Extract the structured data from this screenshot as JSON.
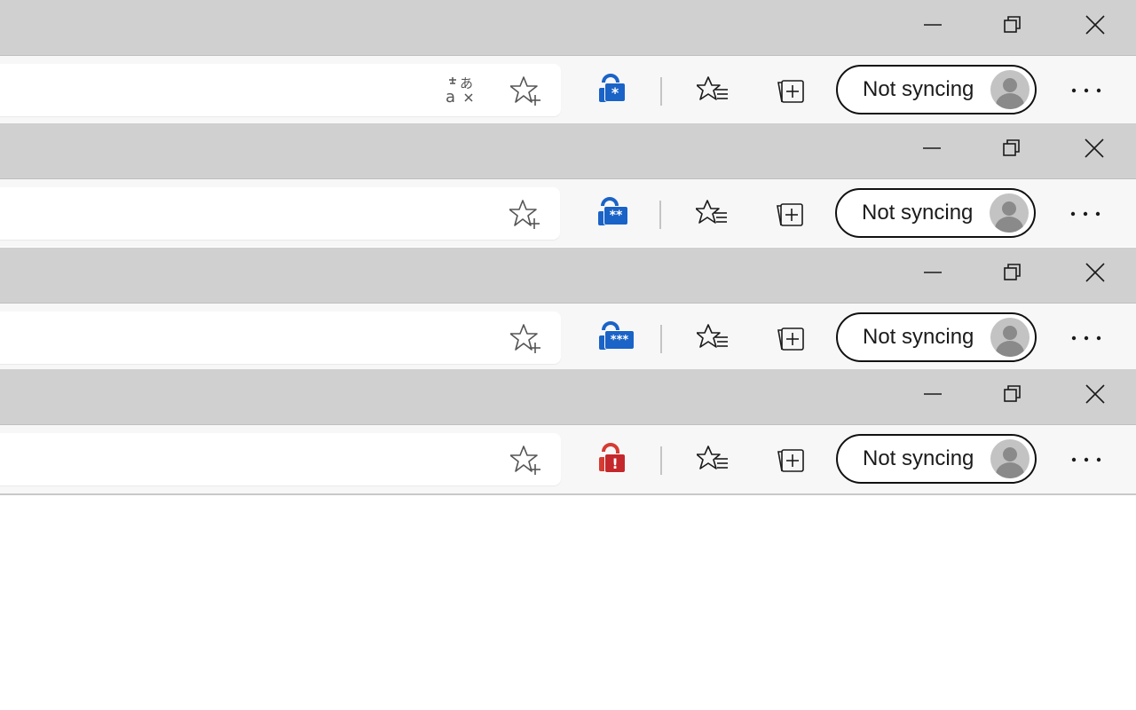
{
  "colors": {
    "titlebar": "#d0d0d0",
    "toolbar": "#f7f7f7",
    "lock_blue": "#1a63c7",
    "lock_red": "#d63b32"
  },
  "window_controls": {
    "minimize_icon": "minimize-icon",
    "restore_icon": "restore-icon",
    "close_icon": "close-icon"
  },
  "instances": [
    {
      "show_translate": true,
      "password_badge": "*",
      "password_state": "saved",
      "profile_label": "Not syncing"
    },
    {
      "show_translate": false,
      "password_badge": "**",
      "password_state": "saved",
      "profile_label": "Not syncing"
    },
    {
      "show_translate": false,
      "password_badge": "***",
      "password_state": "saved",
      "profile_label": "Not syncing"
    },
    {
      "show_translate": false,
      "password_badge": "!",
      "password_state": "warning",
      "profile_label": "Not syncing"
    }
  ]
}
